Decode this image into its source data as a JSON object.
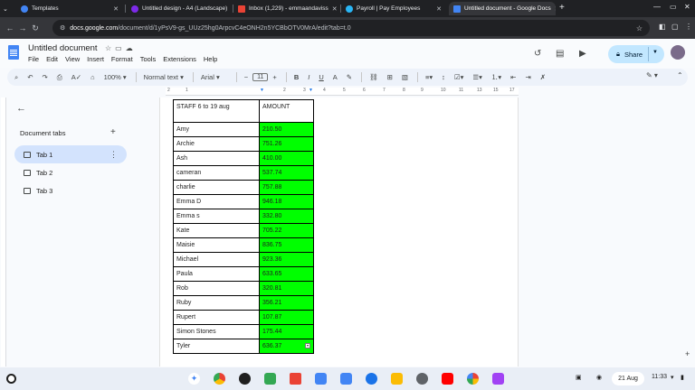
{
  "browser": {
    "tabs": [
      {
        "label": "Templates"
      },
      {
        "label": "Untitled design - A4 (Landscape)"
      },
      {
        "label": "Inbox (1,229) - emmaandaviss"
      },
      {
        "label": "Payroll | Pay Employees"
      },
      {
        "label": "Untitled document - Google Docs"
      }
    ],
    "url_host": "docs.google.com",
    "url_path": "/document/d/1yPsV9-gs_UUz25hg0ArpcvC4eONH2n5YCBbOTV0MrA/edit?tab=t.0"
  },
  "docs": {
    "title": "Untitled document",
    "menu": [
      "File",
      "Edit",
      "View",
      "Insert",
      "Format",
      "Tools",
      "Extensions",
      "Help"
    ],
    "share_label": "Share",
    "toolbar": {
      "zoom": "100%",
      "style": "Normal text",
      "font": "Arial",
      "font_size": "11"
    }
  },
  "ruler": [
    "2",
    "1",
    "1",
    "2",
    "3",
    "4",
    "5",
    "6",
    "7",
    "8",
    "9",
    "10",
    "11",
    "12",
    "13",
    "14",
    "15",
    "16",
    "17",
    "18"
  ],
  "side_panel": {
    "heading": "Document tabs",
    "tabs": [
      {
        "label": "Tab 1"
      },
      {
        "label": "Tab 2"
      },
      {
        "label": "Tab 3"
      }
    ]
  },
  "table": {
    "header": {
      "name": "STAFF 6 to 19 aug",
      "amount": "AMOUNT"
    },
    "rows": [
      {
        "name": "Amy",
        "amount": "210.50"
      },
      {
        "name": "Archie",
        "amount": "751.26"
      },
      {
        "name": "Ash",
        "amount": "410.00"
      },
      {
        "name": "cameran",
        "amount": "537.74"
      },
      {
        "name": "charlie",
        "amount": "757.88"
      },
      {
        "name": "Emma D",
        "amount": "946.18"
      },
      {
        "name": "Emma s",
        "amount": "332.80"
      },
      {
        "name": "Kate",
        "amount": "705.22"
      },
      {
        "name": "Maisie",
        "amount": "836.75"
      },
      {
        "name": "Michael",
        "amount": "923.36"
      },
      {
        "name": "Paula",
        "amount": "633.65"
      },
      {
        "name": "Rob",
        "amount": "320.81"
      },
      {
        "name": "Ruby",
        "amount": "356.21"
      },
      {
        "name": "Rupert",
        "amount": "107.87"
      },
      {
        "name": "Simon Stones",
        "amount": "175.44"
      },
      {
        "name": "Tyler",
        "amount": "636.37"
      }
    ],
    "highlight_color": "#00ff00"
  },
  "shelf": {
    "date": "21 Aug",
    "time": "11:33"
  }
}
